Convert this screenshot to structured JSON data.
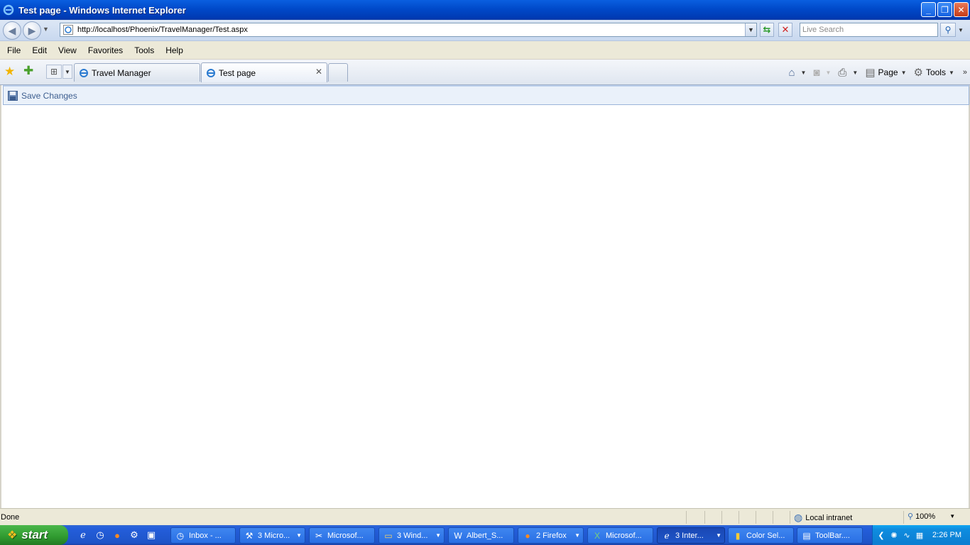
{
  "window": {
    "title": "Test page - Windows Internet Explorer",
    "buttons": {
      "minimize": "_",
      "maximize": "❐",
      "close": "✕"
    }
  },
  "address_bar": {
    "url": "http://localhost/Phoenix/TravelManager/Test.aspx",
    "search_placeholder": "Live Search"
  },
  "menu": {
    "items": [
      "File",
      "Edit",
      "View",
      "Favorites",
      "Tools",
      "Help"
    ]
  },
  "tabs": [
    {
      "label": "Travel Manager",
      "active": false
    },
    {
      "label": "Test page",
      "active": true
    }
  ],
  "command_bar": {
    "page_label": "Page",
    "tools_label": "Tools"
  },
  "page": {
    "toolbar": {
      "save_label": "Save Changes"
    }
  },
  "status": {
    "text": "Done",
    "zone": "Local intranet",
    "zoom": "100%"
  },
  "taskbar": {
    "start_label": "start",
    "tasks": [
      {
        "label": "Inbox - ...",
        "icon": "outlook-icon",
        "active": false,
        "group": false
      },
      {
        "label": "3 Micro...",
        "icon": "visual-studio-icon",
        "active": false,
        "group": true
      },
      {
        "label": "Microsof...",
        "icon": "tools-icon",
        "active": false,
        "group": false
      },
      {
        "label": "3 Wind...",
        "icon": "folder-icon",
        "active": false,
        "group": true
      },
      {
        "label": "Albert_S...",
        "icon": "word-icon",
        "active": false,
        "group": false
      },
      {
        "label": "2 Firefox",
        "icon": "firefox-icon",
        "active": false,
        "group": true
      },
      {
        "label": "Microsof...",
        "icon": "excel-icon",
        "active": false,
        "group": false
      },
      {
        "label": "3 Inter...",
        "icon": "ie-icon",
        "active": true,
        "group": true
      },
      {
        "label": "Color Sel...",
        "icon": "color-selector-icon",
        "active": false,
        "group": false
      },
      {
        "label": "ToolBar....",
        "icon": "document-icon",
        "active": false,
        "group": false
      }
    ],
    "clock": "2:26 PM"
  }
}
